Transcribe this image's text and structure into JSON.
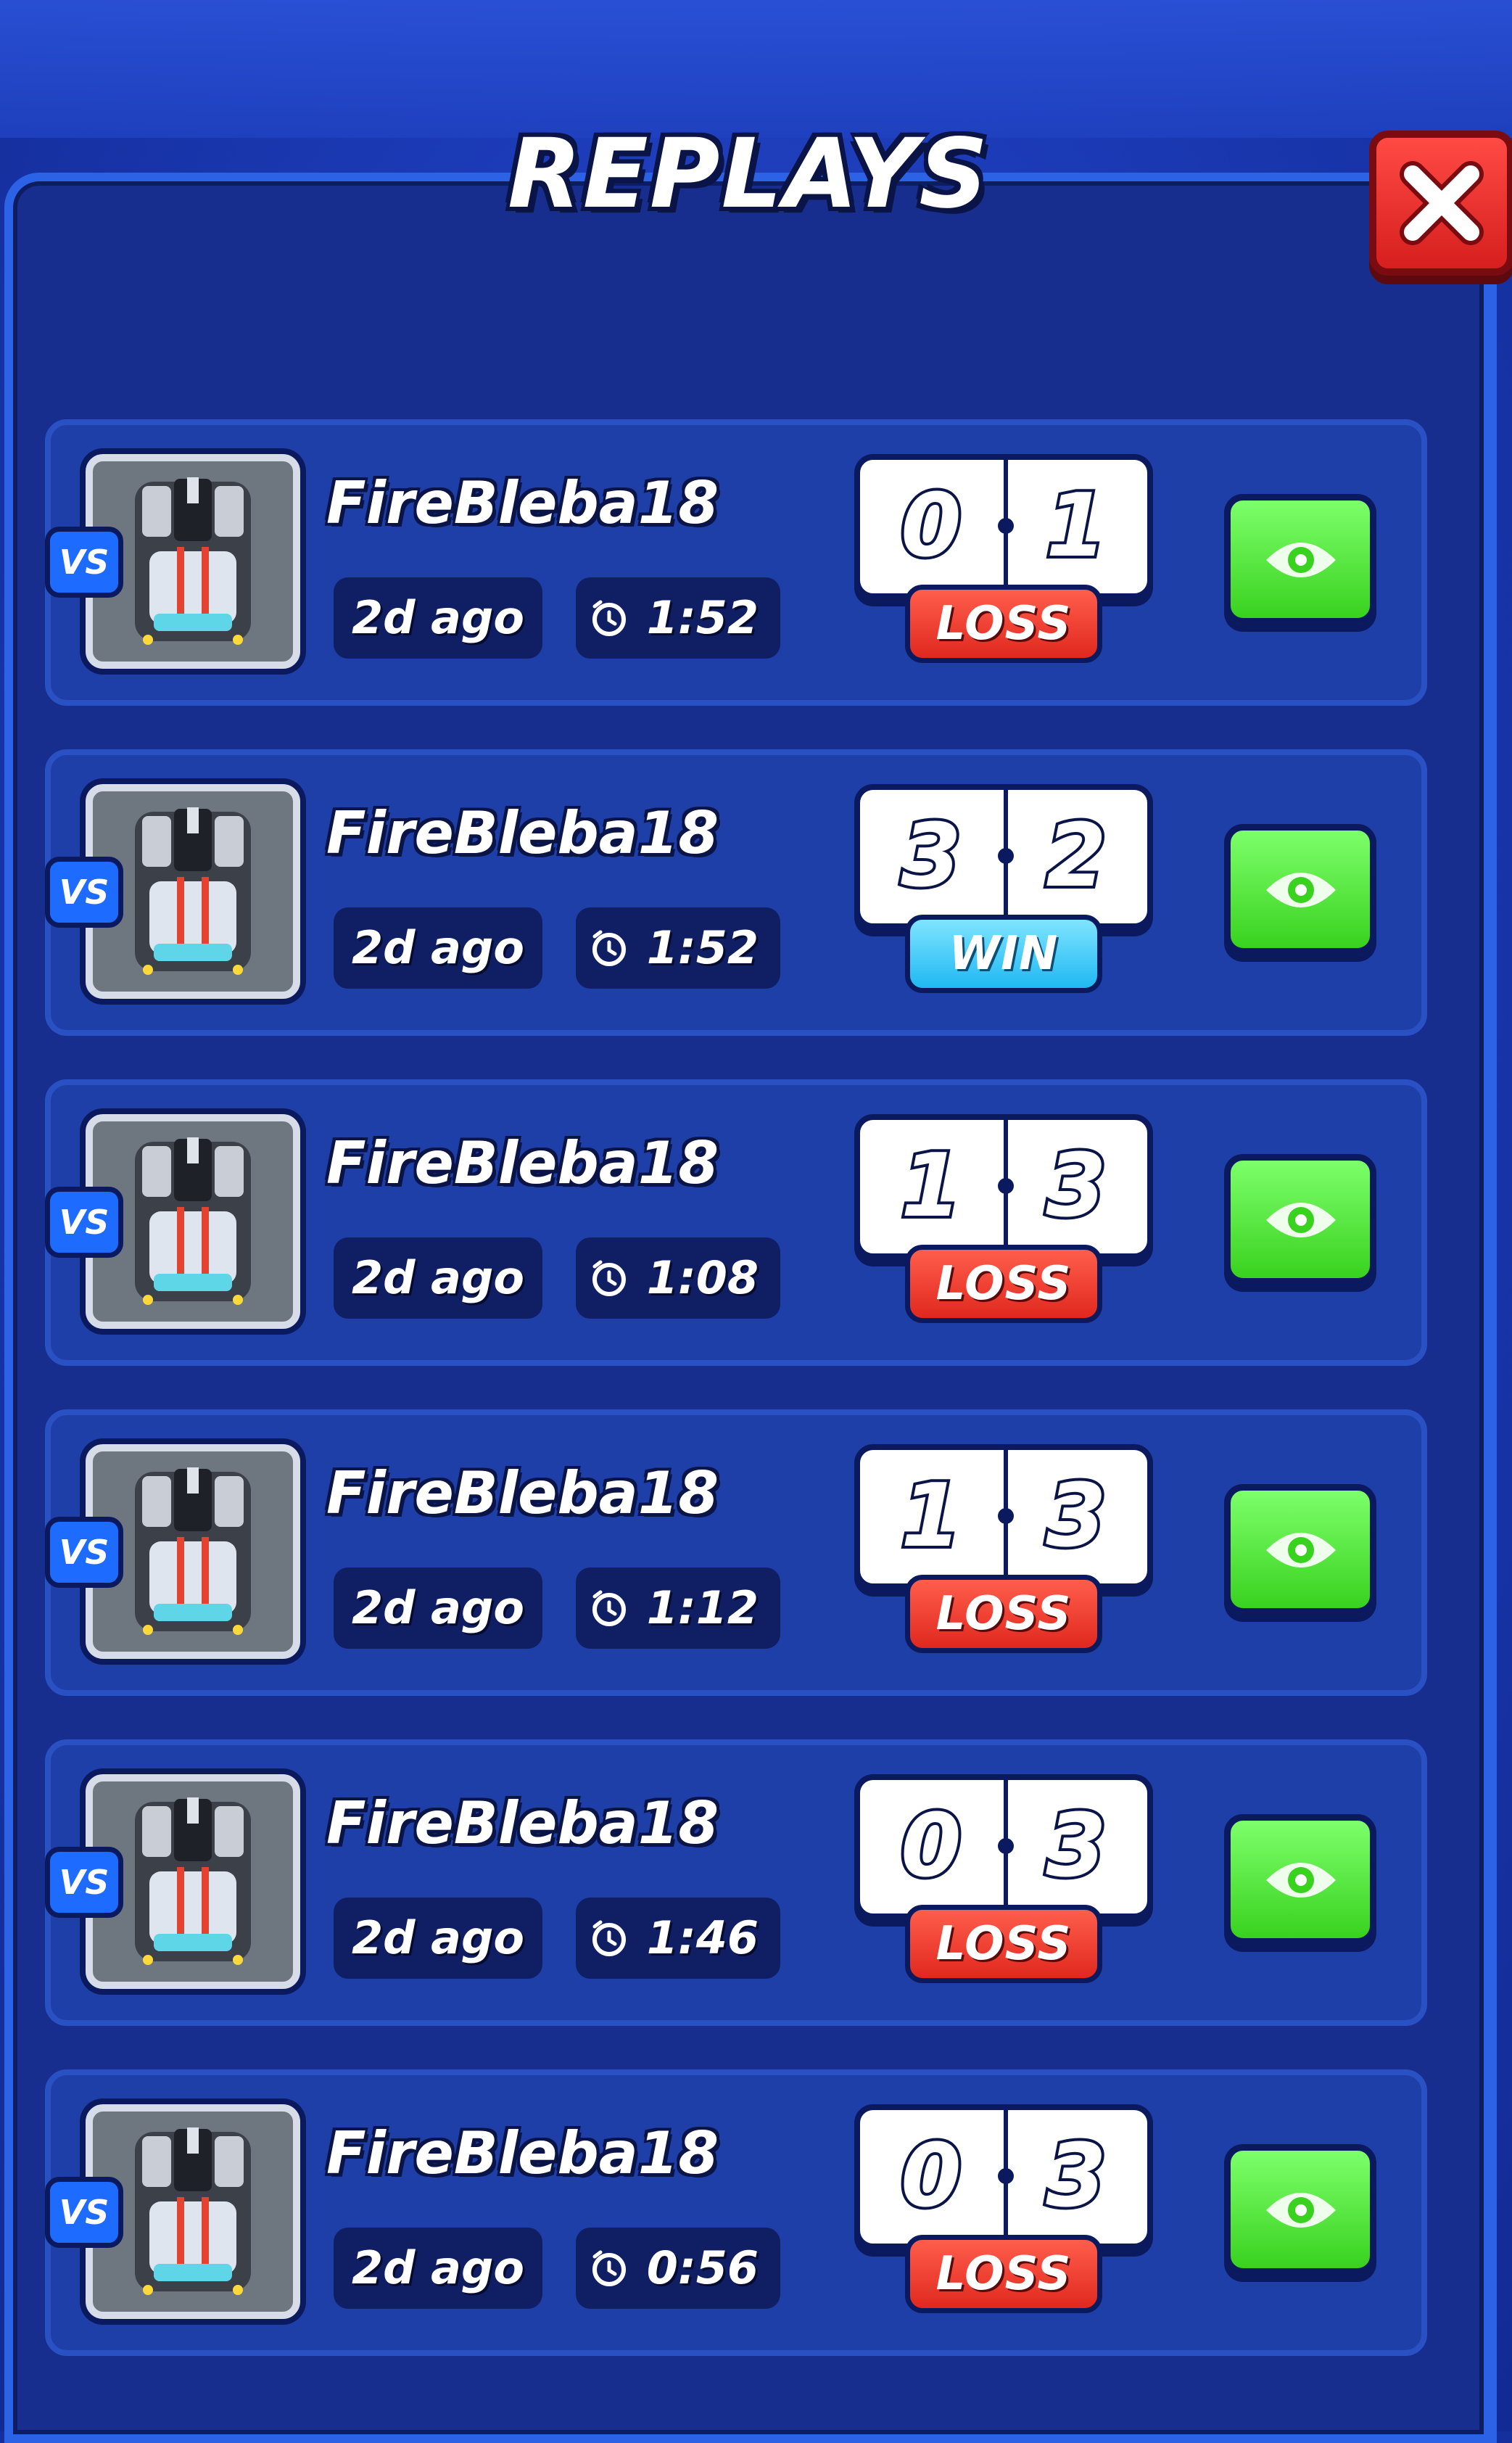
{
  "header": {
    "title": "REPLAYS"
  },
  "colors": {
    "loss": "#e0281f",
    "win": "#1fb8f2",
    "watch": "#39d21f",
    "close": "#d61f1e"
  },
  "icons": {
    "close": "close-icon",
    "watch": "eye-icon",
    "duration": "clock-icon",
    "vs": "vs-badge",
    "avatar": "car-avatar"
  },
  "replays": [
    {
      "vs": "VS",
      "player": "FireBleba18",
      "date": "2d ago",
      "duration": "1:52",
      "score_left": "0",
      "score_right": "1",
      "result": "LOSS"
    },
    {
      "vs": "VS",
      "player": "FireBleba18",
      "date": "2d ago",
      "duration": "1:52",
      "score_left": "3",
      "score_right": "2",
      "result": "WIN"
    },
    {
      "vs": "VS",
      "player": "FireBleba18",
      "date": "2d ago",
      "duration": "1:08",
      "score_left": "1",
      "score_right": "3",
      "result": "LOSS"
    },
    {
      "vs": "VS",
      "player": "FireBleba18",
      "date": "2d ago",
      "duration": "1:12",
      "score_left": "1",
      "score_right": "3",
      "result": "LOSS"
    },
    {
      "vs": "VS",
      "player": "FireBleba18",
      "date": "2d ago",
      "duration": "1:46",
      "score_left": "0",
      "score_right": "3",
      "result": "LOSS"
    },
    {
      "vs": "VS",
      "player": "FireBleba18",
      "date": "2d ago",
      "duration": "0:56",
      "score_left": "0",
      "score_right": "3",
      "result": "LOSS"
    }
  ]
}
